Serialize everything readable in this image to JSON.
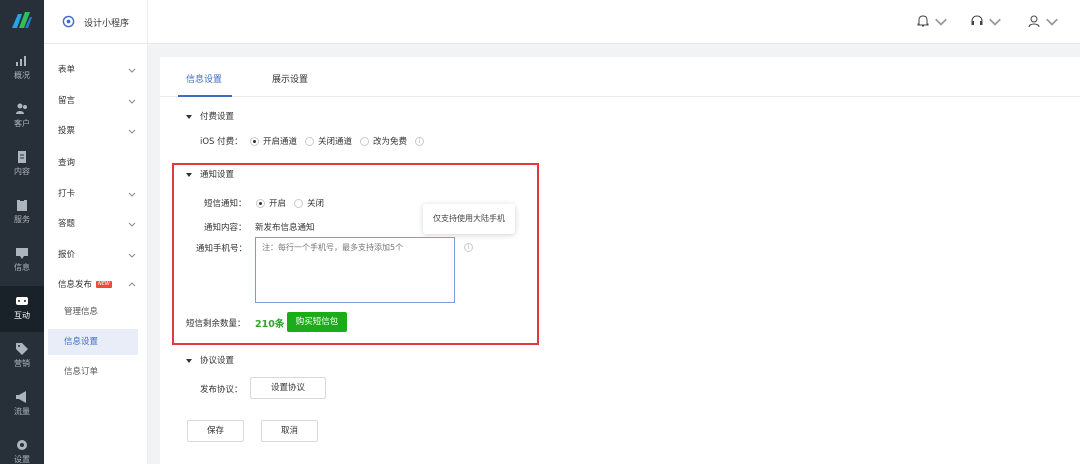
{
  "app": {
    "name": "设计小程序"
  },
  "rail": [
    {
      "label": "概况",
      "icon": "chart-icon"
    },
    {
      "label": "客户",
      "icon": "users-icon"
    },
    {
      "label": "内容",
      "icon": "document-icon"
    },
    {
      "label": "服务",
      "icon": "clipboard-icon"
    },
    {
      "label": "信息",
      "icon": "message-icon"
    },
    {
      "label": "互动",
      "icon": "gamepad-icon"
    },
    {
      "label": "营销",
      "icon": "tag-icon"
    },
    {
      "label": "流量",
      "icon": "megaphone-icon"
    },
    {
      "label": "设置",
      "icon": "gear-icon"
    }
  ],
  "subnav": {
    "items": [
      {
        "label": "表单",
        "expandable": true
      },
      {
        "label": "留言",
        "expandable": true
      },
      {
        "label": "投票",
        "expandable": true
      },
      {
        "label": "查询",
        "expandable": false
      },
      {
        "label": "打卡",
        "expandable": true
      },
      {
        "label": "答题",
        "expandable": true
      },
      {
        "label": "报价",
        "expandable": true
      },
      {
        "label": "信息发布",
        "expandable": true,
        "badge": "NEW"
      },
      {
        "label": "管理信息"
      },
      {
        "label": "信息设置"
      },
      {
        "label": "信息订单"
      }
    ]
  },
  "tabs": [
    {
      "label": "信息设置"
    },
    {
      "label": "展示设置"
    }
  ],
  "payment": {
    "title": "付费设置",
    "ios_label": "iOS 付费：",
    "options": [
      "开启通道",
      "关闭通道",
      "改为免费"
    ],
    "selected": 0
  },
  "notify": {
    "title": "通知设置",
    "sms_label": "短信通知：",
    "sms_options": [
      "开启",
      "关闭"
    ],
    "sms_selected": 0,
    "content_label": "通知内容：",
    "content_value": "新发布信息通知",
    "phone_label": "通知手机号：",
    "phone_placeholder": "注：每行一个手机号，最多支持添加5个",
    "tooltip": "仅支持使用大陆手机",
    "remaining_label": "短信剩余数量：",
    "remaining_value": "210条",
    "buy_button": "购买短信包"
  },
  "agreement": {
    "title": "协议设置",
    "label": "发布协议：",
    "button": "设置协议"
  },
  "actions": {
    "save": "保存",
    "cancel": "取消"
  },
  "colors": {
    "accent": "#3f6cc6",
    "green": "#1aad19",
    "highlight": "#e23a3a"
  }
}
